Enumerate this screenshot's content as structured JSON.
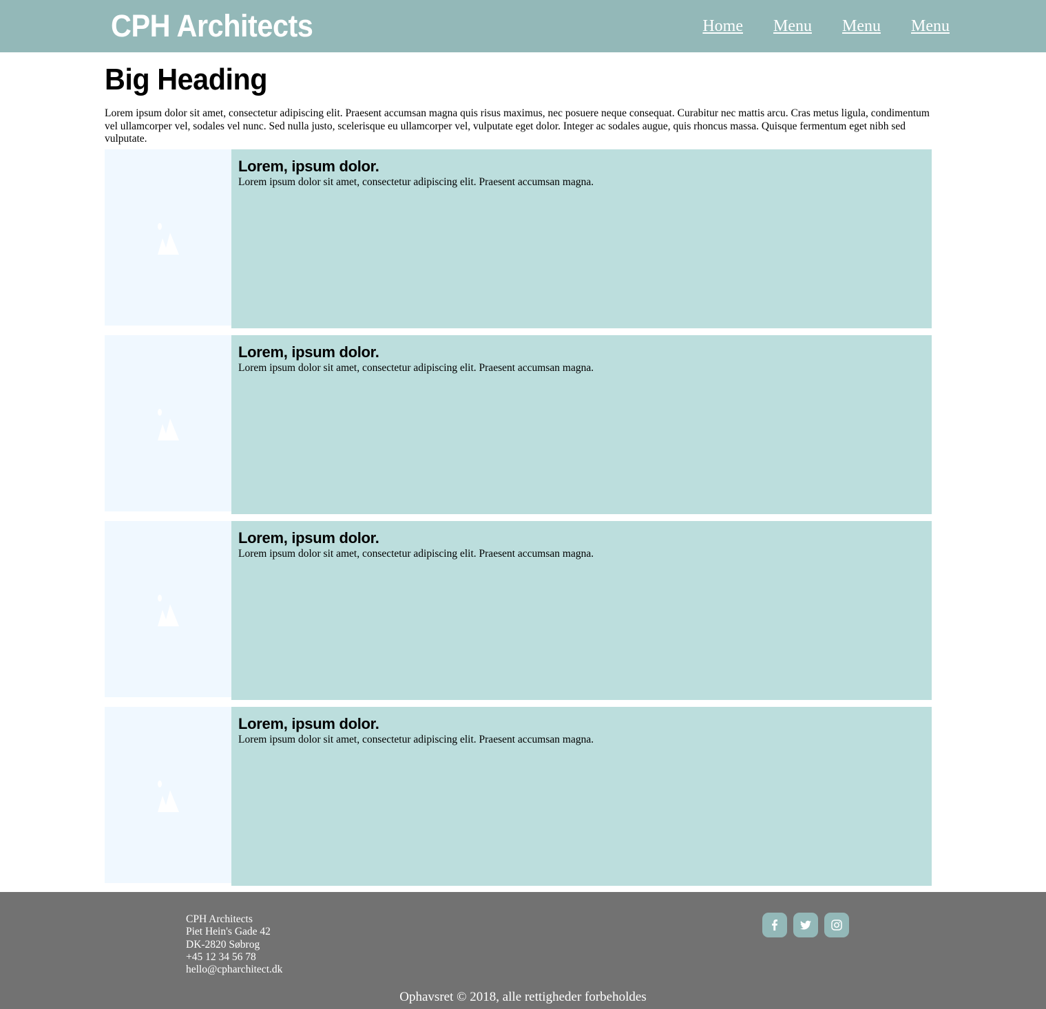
{
  "header": {
    "logo": "CPH Architects",
    "nav": [
      {
        "label": "Home"
      },
      {
        "label": "Menu"
      },
      {
        "label": "Menu"
      },
      {
        "label": "Menu"
      }
    ]
  },
  "main": {
    "heading": "Big Heading",
    "intro": "Lorem ipsum dolor sit amet, consectetur adipiscing elit. Praesent accumsan magna quis risus maximus, nec posuere neque consequat. Curabitur nec mattis arcu. Cras metus ligula, condimentum vel ullamcorper vel, sodales vel nunc. Sed nulla justo, scelerisque eu ullamcorper vel, vulputate eget dolor. Integer ac sodales augue, quis rhoncus massa. Quisque fermentum eget nibh sed vulputate.",
    "cards": [
      {
        "title": "Lorem, ipsum dolor.",
        "text": "Lorem ipsum dolor sit amet, consectetur adipiscing elit. Praesent accumsan magna.",
        "icon": "image-placeholder-icon"
      },
      {
        "title": "Lorem, ipsum dolor.",
        "text": "Lorem ipsum dolor sit amet, consectetur adipiscing elit. Praesent accumsan magna.",
        "icon": "image-placeholder-icon"
      },
      {
        "title": "Lorem, ipsum dolor.",
        "text": "Lorem ipsum dolor sit amet, consectetur adipiscing elit. Praesent accumsan magna.",
        "icon": "image-placeholder-icon"
      },
      {
        "title": "Lorem, ipsum dolor.",
        "text": "Lorem ipsum dolor sit amet, consectetur adipiscing elit. Praesent accumsan magna.",
        "icon": "image-placeholder-icon"
      }
    ]
  },
  "footer": {
    "address": {
      "name": "CPH Architects",
      "street": "Piet Hein's Gade 42",
      "city": "DK-2820 Søbrog",
      "phone": "+45 12 34 56 78",
      "email": "hello@cpharchitect.dk"
    },
    "social": [
      {
        "icon": "facebook-icon"
      },
      {
        "icon": "twitter-icon"
      },
      {
        "icon": "instagram-icon"
      }
    ],
    "copyright": "Ophavsret © 2018, alle rettigheder forbeholdes"
  },
  "colors": {
    "header_bg": "#93b8b8",
    "card_bg": "#bcdedd",
    "image_bg": "#f0f8ff",
    "footer_bg": "#727272"
  }
}
